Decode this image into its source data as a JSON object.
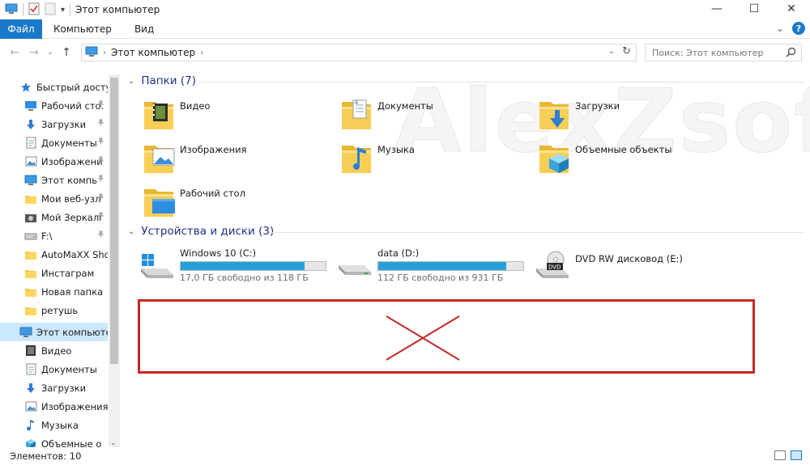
{
  "window": {
    "title": "Этот компьютер"
  },
  "ribbon": {
    "tabs": [
      "Файл",
      "Компьютер",
      "Вид"
    ]
  },
  "address": {
    "path": "Этот компьютер"
  },
  "search": {
    "placeholder": "Поиск: Этот компьютер"
  },
  "sidebar": {
    "items": [
      {
        "label": "Быстрый доступ",
        "icon": "star-icon",
        "pinned": false
      },
      {
        "label": "Рабочий сто.",
        "icon": "desktop-icon",
        "pinned": true
      },
      {
        "label": "Загрузки",
        "icon": "download-icon",
        "pinned": true
      },
      {
        "label": "Документы",
        "icon": "document-icon",
        "pinned": true
      },
      {
        "label": "Изображени",
        "icon": "image-icon",
        "pinned": true
      },
      {
        "label": "Этот компь",
        "icon": "computer-icon",
        "pinned": true
      },
      {
        "label": "Мои веб-узл",
        "icon": "folder-icon",
        "pinned": true
      },
      {
        "label": "Мой Зеркалі",
        "icon": "camera-icon",
        "pinned": true
      },
      {
        "label": "F:\\",
        "icon": "drive-icon",
        "pinned": true
      },
      {
        "label": "AutoMaXX Show",
        "icon": "folder-icon",
        "pinned": false
      },
      {
        "label": "Инстаграм",
        "icon": "folder-icon",
        "pinned": false
      },
      {
        "label": "Новая папка",
        "icon": "folder-icon",
        "pinned": false
      },
      {
        "label": "ретушь",
        "icon": "folder-icon",
        "pinned": false
      },
      {
        "label": "Этот компьютер",
        "icon": "computer-icon",
        "pinned": false,
        "selected": true
      },
      {
        "label": "Видео",
        "icon": "video-icon",
        "pinned": false
      },
      {
        "label": "Документы",
        "icon": "document-icon",
        "pinned": false
      },
      {
        "label": "Загрузки",
        "icon": "download-icon",
        "pinned": false
      },
      {
        "label": "Изображения",
        "icon": "image-icon",
        "pinned": false
      },
      {
        "label": "Музыка",
        "icon": "music-icon",
        "pinned": false
      },
      {
        "label": "Объемные о",
        "icon": "cube-icon",
        "pinned": false
      }
    ]
  },
  "folders_group": {
    "header": "Папки (7)",
    "items": [
      {
        "label": "Видео",
        "icon": "video-folder-icon"
      },
      {
        "label": "Документы",
        "icon": "documents-folder-icon"
      },
      {
        "label": "Загрузки",
        "icon": "downloads-folder-icon"
      },
      {
        "label": "Изображения",
        "icon": "pictures-folder-icon"
      },
      {
        "label": "Музыка",
        "icon": "music-folder-icon"
      },
      {
        "label": "Объемные объекты",
        "icon": "3d-objects-folder-icon"
      },
      {
        "label": "Рабочий стол",
        "icon": "desktop-folder-icon"
      }
    ]
  },
  "devices_group": {
    "header": "Устройства и диски (3)",
    "items": [
      {
        "label": "Windows 10 (C:)",
        "free": "17,0 ГБ свободно из 118 ГБ",
        "used_fraction": 0.856,
        "icon": "windows-drive-icon"
      },
      {
        "label": "data (D:)",
        "free": "112 ГБ свободно из 931 ГБ",
        "used_fraction": 0.88,
        "icon": "hard-drive-icon"
      },
      {
        "label": "DVD RW дисковод (E:)",
        "icon": "dvd-drive-icon"
      }
    ]
  },
  "status": {
    "count": "Элементов: 10"
  },
  "watermark": {
    "text": "AlexZsoft.ru"
  },
  "colors": {
    "accent": "#1979ca",
    "selection": "#cce8ff",
    "group_header": "#1e3287",
    "drive_bar": "#26a0da",
    "annotation": "#c62828"
  }
}
